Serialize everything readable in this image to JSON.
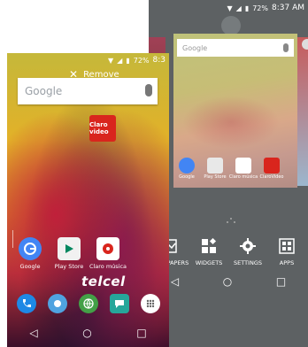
{
  "back_screen": {
    "status": {
      "battery": "72%",
      "time": "8:37 AM"
    },
    "search": {
      "logo": "Google"
    },
    "mini_apps": [
      {
        "label": "Google",
        "color": "#4285f4"
      },
      {
        "label": "Play Store",
        "color": "#e8e8e8"
      },
      {
        "label": "Claro música",
        "color": "#ffffff"
      },
      {
        "label": "ClaroVideo",
        "color": "#d9251d"
      }
    ],
    "actions": [
      {
        "label": "WALLPAPERS",
        "icon": "wallpaper-icon"
      },
      {
        "label": "WIDGETS",
        "icon": "widgets-icon"
      },
      {
        "label": "SETTINGS",
        "icon": "gear-icon"
      },
      {
        "label": "APPS",
        "icon": "apps-icon"
      }
    ],
    "nav": {
      "back": "◁",
      "home": "○",
      "recents": "□"
    }
  },
  "front_screen": {
    "status": {
      "battery": "72%",
      "time": "8:3"
    },
    "remove_label": "Remove",
    "search": {
      "logo": "Google"
    },
    "claro_video": {
      "label": "Claro video"
    },
    "apps": [
      {
        "label": "Google",
        "icon": "google-icon"
      },
      {
        "label": "Play Store",
        "icon": "play-store-icon"
      },
      {
        "label": "Claro música",
        "icon": "claro-musica-icon"
      }
    ],
    "brand": "telcel",
    "dock": [
      {
        "name": "phone",
        "icon": "phone-icon"
      },
      {
        "name": "telcel",
        "icon": "telcel-icon"
      },
      {
        "name": "browser",
        "icon": "globe-icon"
      },
      {
        "name": "messages",
        "icon": "message-icon"
      },
      {
        "name": "apps",
        "icon": "apps-icon"
      }
    ],
    "nav": {
      "back": "◁",
      "home": "○",
      "recents": "□"
    }
  }
}
